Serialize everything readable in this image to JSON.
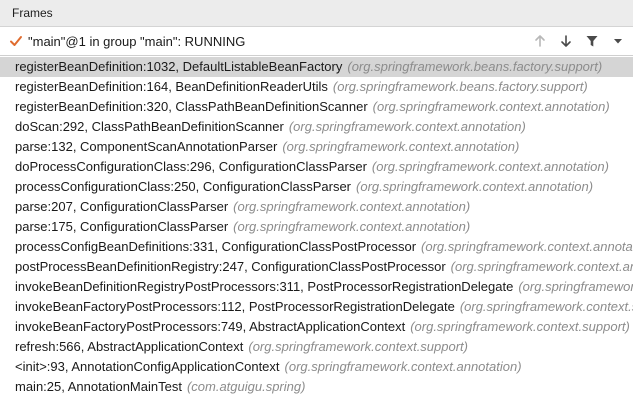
{
  "header": {
    "title": "Frames"
  },
  "thread": {
    "label": "\"main\"@1 in group \"main\": RUNNING",
    "status_icon": "check-icon",
    "status_color": "#e06c2f"
  },
  "toolbar": {
    "up_icon": "arrow-up-icon",
    "down_icon": "arrow-down-icon",
    "filter_icon": "filter-icon",
    "more_icon": "chevron-down-icon"
  },
  "colors": {
    "selected_row": "#d5d5d5",
    "package_text": "#8c8c8c"
  },
  "frames": [
    {
      "method": "registerBeanDefinition:1032, DefaultListableBeanFactory",
      "package": "(org.springframework.beans.factory.support)",
      "selected": true
    },
    {
      "method": "registerBeanDefinition:164, BeanDefinitionReaderUtils",
      "package": "(org.springframework.beans.factory.support)",
      "selected": false
    },
    {
      "method": "registerBeanDefinition:320, ClassPathBeanDefinitionScanner",
      "package": "(org.springframework.context.annotation)",
      "selected": false
    },
    {
      "method": "doScan:292, ClassPathBeanDefinitionScanner",
      "package": "(org.springframework.context.annotation)",
      "selected": false
    },
    {
      "method": "parse:132, ComponentScanAnnotationParser",
      "package": "(org.springframework.context.annotation)",
      "selected": false
    },
    {
      "method": "doProcessConfigurationClass:296, ConfigurationClassParser",
      "package": "(org.springframework.context.annotation)",
      "selected": false
    },
    {
      "method": "processConfigurationClass:250, ConfigurationClassParser",
      "package": "(org.springframework.context.annotation)",
      "selected": false
    },
    {
      "method": "parse:207, ConfigurationClassParser",
      "package": "(org.springframework.context.annotation)",
      "selected": false
    },
    {
      "method": "parse:175, ConfigurationClassParser",
      "package": "(org.springframework.context.annotation)",
      "selected": false
    },
    {
      "method": "processConfigBeanDefinitions:331, ConfigurationClassPostProcessor",
      "package": "(org.springframework.context.annotation)",
      "selected": false
    },
    {
      "method": "postProcessBeanDefinitionRegistry:247, ConfigurationClassPostProcessor",
      "package": "(org.springframework.context.annotation)",
      "selected": false
    },
    {
      "method": "invokeBeanDefinitionRegistryPostProcessors:311, PostProcessorRegistrationDelegate",
      "package": "(org.springframework.context.support)",
      "selected": false
    },
    {
      "method": "invokeBeanFactoryPostProcessors:112, PostProcessorRegistrationDelegate",
      "package": "(org.springframework.context.support)",
      "selected": false
    },
    {
      "method": "invokeBeanFactoryPostProcessors:749, AbstractApplicationContext",
      "package": "(org.springframework.context.support)",
      "selected": false
    },
    {
      "method": "refresh:566, AbstractApplicationContext",
      "package": "(org.springframework.context.support)",
      "selected": false
    },
    {
      "method": "<init>:93, AnnotationConfigApplicationContext",
      "package": "(org.springframework.context.annotation)",
      "selected": false
    },
    {
      "method": "main:25, AnnotationMainTest",
      "package": "(com.atguigu.spring)",
      "selected": false
    }
  ]
}
